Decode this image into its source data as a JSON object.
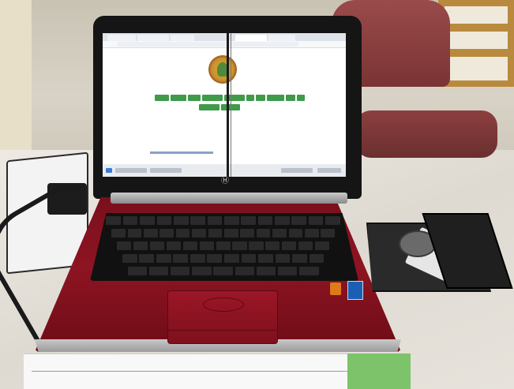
{
  "scene": {
    "description_tags": [
      "laptop-photo",
      "open-browser",
      "optical-drive-tray"
    ],
    "colors": {
      "laptop_body": "#8e1422",
      "keyboard": "#111111",
      "screen_bg": "#ffffff",
      "nav_buttons": "#3f9a4a",
      "logo_gold": "#c9902a"
    },
    "icons": [
      "hp-logo-icon",
      "emblem-logo-icon",
      "intel-sticker-icon"
    ]
  }
}
